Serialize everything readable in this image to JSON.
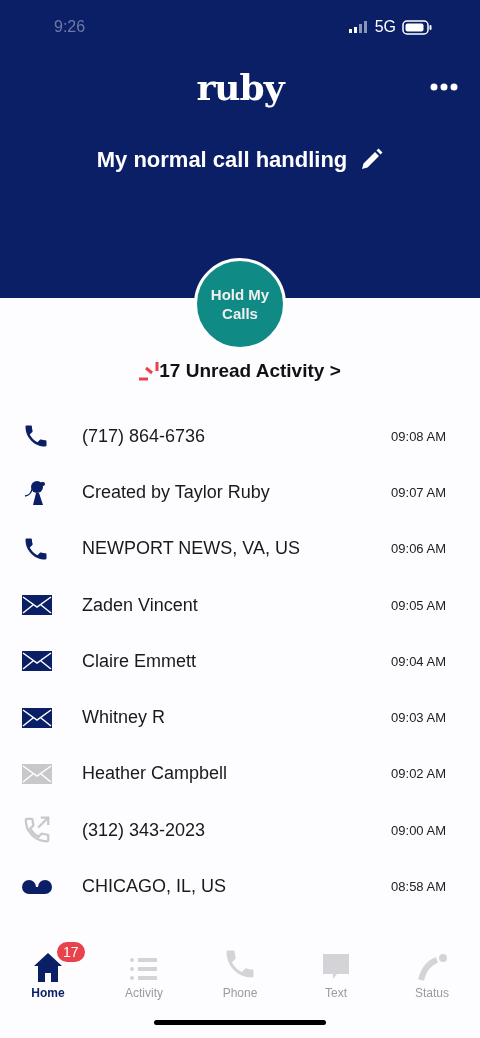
{
  "status_bar": {
    "time": "9:26",
    "network": "5G"
  },
  "header": {
    "logo": "ruby",
    "title": "My normal call handling"
  },
  "hold_button": {
    "label": "Hold My Calls"
  },
  "unread_link": {
    "label": "17 Unread Activity >"
  },
  "activity": [
    {
      "kind": "call",
      "unread": true,
      "name": "(717) 864-6736",
      "time": "09:08 AM"
    },
    {
      "kind": "agent",
      "unread": true,
      "name": "Created by Taylor Ruby",
      "time": "09:07 AM"
    },
    {
      "kind": "call",
      "unread": true,
      "name": "NEWPORT NEWS, VA, US",
      "time": "09:06 AM"
    },
    {
      "kind": "message",
      "unread": true,
      "name": "Zaden Vincent",
      "time": "09:05 AM"
    },
    {
      "kind": "message",
      "unread": true,
      "name": "Claire Emmett",
      "time": "09:04 AM"
    },
    {
      "kind": "message",
      "unread": true,
      "name": "Whitney R",
      "time": "09:03 AM"
    },
    {
      "kind": "message",
      "unread": false,
      "name": "Heather Campbell",
      "time": "09:02 AM"
    },
    {
      "kind": "outgoing",
      "unread": false,
      "name": "(312) 343-2023",
      "time": "09:00 AM"
    },
    {
      "kind": "voicemail",
      "unread": true,
      "name": "CHICAGO, IL, US",
      "time": "08:58 AM"
    }
  ],
  "tabs": [
    {
      "kind": "home",
      "label": "Home",
      "selected": true,
      "badge": "17"
    },
    {
      "kind": "activity",
      "label": "Activity",
      "selected": false
    },
    {
      "kind": "phone",
      "label": "Phone",
      "selected": false
    },
    {
      "kind": "text",
      "label": "Text",
      "selected": false
    },
    {
      "kind": "status",
      "label": "Status",
      "selected": false
    }
  ]
}
